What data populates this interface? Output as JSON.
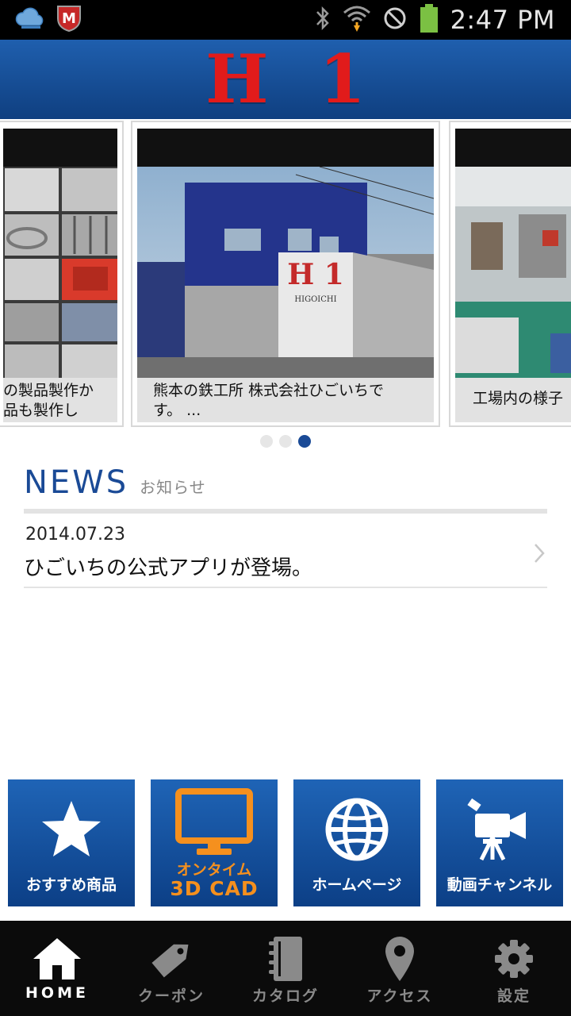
{
  "status_bar": {
    "time": "2:47 PM",
    "icons": [
      "cloud-icon",
      "mcafee-icon",
      "bluetooth-icon",
      "wifi-icon",
      "no-sync-icon",
      "battery-icon"
    ]
  },
  "header": {
    "logo": "H1"
  },
  "carousel": {
    "slides": [
      {
        "caption": "の製品製作か\n品も製作して..."
      },
      {
        "caption": "熊本の鉄工所 株式会社ひごいちで\nす。 ...",
        "sign_text": "H 1",
        "sign_sub": "HIGOICHI"
      },
      {
        "caption": "工場内の様子"
      }
    ],
    "page_count": 3,
    "active_page": 2
  },
  "news": {
    "title": "NEWS",
    "subtitle": "お知らせ",
    "items": [
      {
        "date": "2014.07.23",
        "text": "ひごいちの公式アプリが登場。"
      }
    ]
  },
  "tiles": [
    {
      "label": "おすすめ商品",
      "icon": "star-icon"
    },
    {
      "label_line1": "オンタイム",
      "label_line2": "3D CAD",
      "icon": "monitor-icon"
    },
    {
      "label": "ホームページ",
      "icon": "globe-icon"
    },
    {
      "label": "動画チャンネル",
      "icon": "video-camera-icon"
    }
  ],
  "bottom_nav": {
    "items": [
      {
        "label": "HOME",
        "icon": "home-icon",
        "active": true
      },
      {
        "label": "クーポン",
        "icon": "tag-icon",
        "active": false
      },
      {
        "label": "カタログ",
        "icon": "notebook-icon",
        "active": false
      },
      {
        "label": "アクセス",
        "icon": "map-pin-icon",
        "active": false
      },
      {
        "label": "設定",
        "icon": "gear-icon",
        "active": false
      }
    ]
  },
  "colors": {
    "header_blue": "#174f97",
    "logo_red": "#e11b1b",
    "news_blue": "#1a4a96",
    "tile_blue": "#0c3f86",
    "cad_orange": "#f5901e"
  }
}
